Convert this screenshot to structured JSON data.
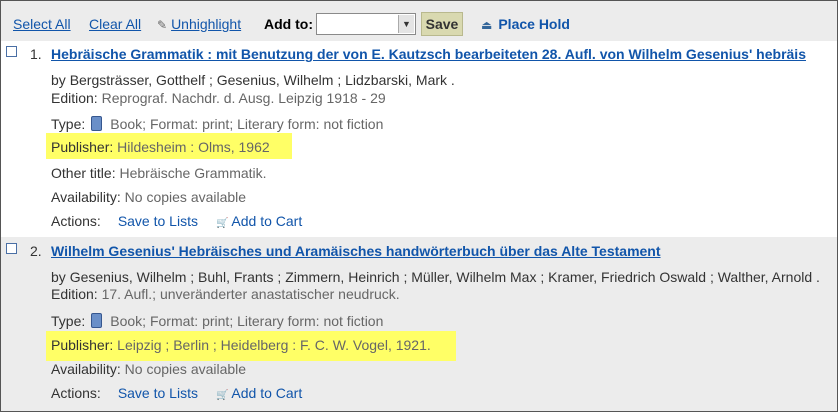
{
  "toolbar": {
    "select_all": "Select All",
    "clear_all": "Clear All",
    "unhighlight": "Unhighlight",
    "add_to": "Add to:",
    "list_value": "",
    "save": "Save",
    "place_hold": "Place Hold"
  },
  "labels": {
    "by": "by",
    "edition": "Edition:",
    "type": "Type:",
    "format": "; Format:",
    "literary": "; Literary form:",
    "publisher": "Publisher:",
    "other_title": "Other title:",
    "availability": "Availability:",
    "actions": "Actions:",
    "save_to_lists": "Save to Lists",
    "add_to_cart": "Add to Cart"
  },
  "results": [
    {
      "number": "1.",
      "title": "Hebräische Grammatik : mit Benutzung der von E. Kautzsch bearbeiteten 28. Aufl. von Wilhelm Gesenius' hebräis",
      "authors": "Bergsträsser, Gotthelf ; Gesenius, Wilhelm ; Lidzbarski, Mark .",
      "edition": "Reprograf. Nachdr. d. Ausg. Leipzig 1918 - 29",
      "type": "Book",
      "format": "print",
      "literary_form": "not fiction",
      "publisher": "Hildesheim : Olms, 1962",
      "other_title": "Hebräische Grammatik.",
      "availability": "No copies available"
    },
    {
      "number": "2.",
      "title": "Wilhelm Gesenius' Hebräisches und Aramäisches handwörterbuch über das Alte Testament",
      "authors": "Gesenius, Wilhelm ; Buhl, Frants ; Zimmern, Heinrich ; Müller, Wilhelm Max ; Kramer, Friedrich Oswald ; Walther, Arnold .",
      "edition": "17. Aufl.; unveränderter anastatischer neudruck.",
      "type": "Book",
      "format": "print",
      "literary_form": "not fiction",
      "publisher": "Leipzig ; Berlin ; Heidelberg : F. C. W. Vogel, 1921.",
      "availability": "No copies available"
    }
  ],
  "colors": {
    "link": "#1155aa",
    "highlight": "#ffff66",
    "toolbar_bg": "#ececec"
  },
  "icons": {
    "unhighlight": "pencil-icon",
    "place_hold": "hold-icon",
    "type": "book-icon",
    "cart": "cart-icon"
  }
}
